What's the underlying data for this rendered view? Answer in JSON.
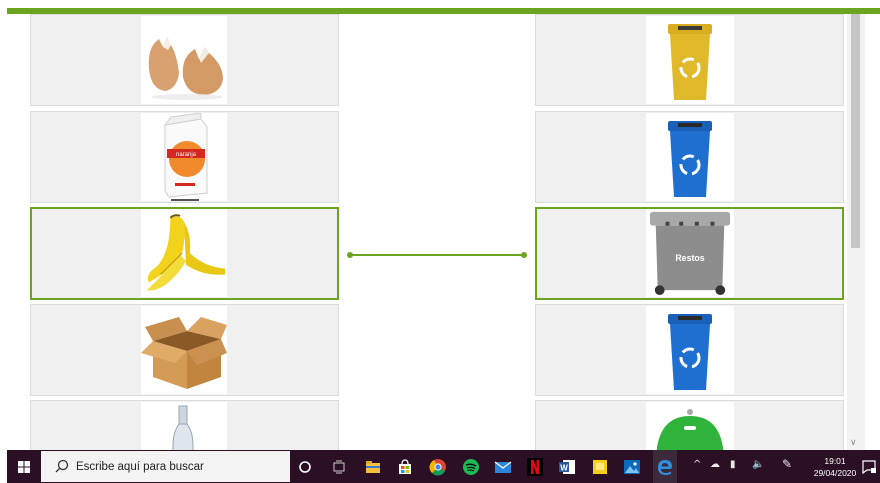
{
  "left_column": {
    "items": [
      {
        "name": "eggshell",
        "selected": false
      },
      {
        "name": "juice-carton",
        "selected": false,
        "carton_label": "naranja"
      },
      {
        "name": "banana-peel",
        "selected": true
      },
      {
        "name": "cardboard-box",
        "selected": false
      },
      {
        "name": "glass-bottle",
        "selected": false
      }
    ]
  },
  "right_column": {
    "items": [
      {
        "name": "yellow-bin",
        "color": "#e0b92b",
        "selected": false
      },
      {
        "name": "blue-bin",
        "color": "#1f6fd1",
        "selected": false
      },
      {
        "name": "grey-bin",
        "color": "#8d8d8d",
        "selected": true,
        "label": "Restos"
      },
      {
        "name": "blue-bin",
        "color": "#1f6fd1",
        "selected": false
      },
      {
        "name": "green-igloo",
        "color": "#2fb33a",
        "selected": false
      }
    ]
  },
  "colors": {
    "accent": "#6ba421",
    "taskbar": "#2b0f25"
  },
  "taskbar": {
    "search_placeholder": "Escribe aquí para buscar",
    "time": "19:01",
    "date": "29/04/2020"
  }
}
